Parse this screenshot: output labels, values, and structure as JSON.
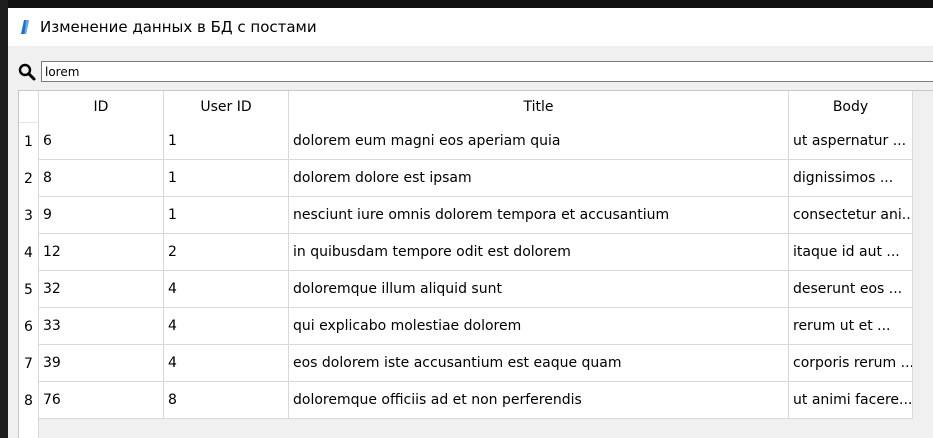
{
  "window": {
    "title": "Изменение данных в БД с постами"
  },
  "search": {
    "value": "lorem",
    "icon": "search-icon"
  },
  "table": {
    "columns": [
      "ID",
      "User ID",
      "Title",
      "Body"
    ],
    "row_numbers": [
      "1",
      "2",
      "3",
      "4",
      "5",
      "6",
      "7",
      "8"
    ],
    "rows": [
      [
        "6",
        "1",
        "dolorem eum magni eos aperiam quia",
        "ut aspernatur ..."
      ],
      [
        "8",
        "1",
        "dolorem dolore est ipsam",
        "dignissimos ..."
      ],
      [
        "9",
        "1",
        "nesciunt iure omnis dolorem tempora et accusantium",
        "consectetur ani..."
      ],
      [
        "12",
        "2",
        "in quibusdam tempore odit est dolorem",
        "itaque id aut ..."
      ],
      [
        "32",
        "4",
        "doloremque illum aliquid sunt",
        "deserunt eos ..."
      ],
      [
        "33",
        "4",
        "qui explicabo molestiae dolorem",
        "rerum ut et ..."
      ],
      [
        "39",
        "4",
        "eos dolorem iste accusantium est eaque quam",
        "corporis rerum ..."
      ],
      [
        "76",
        "8",
        "doloremque officiis ad et non perferendis",
        "ut animi facere..."
      ]
    ]
  }
}
